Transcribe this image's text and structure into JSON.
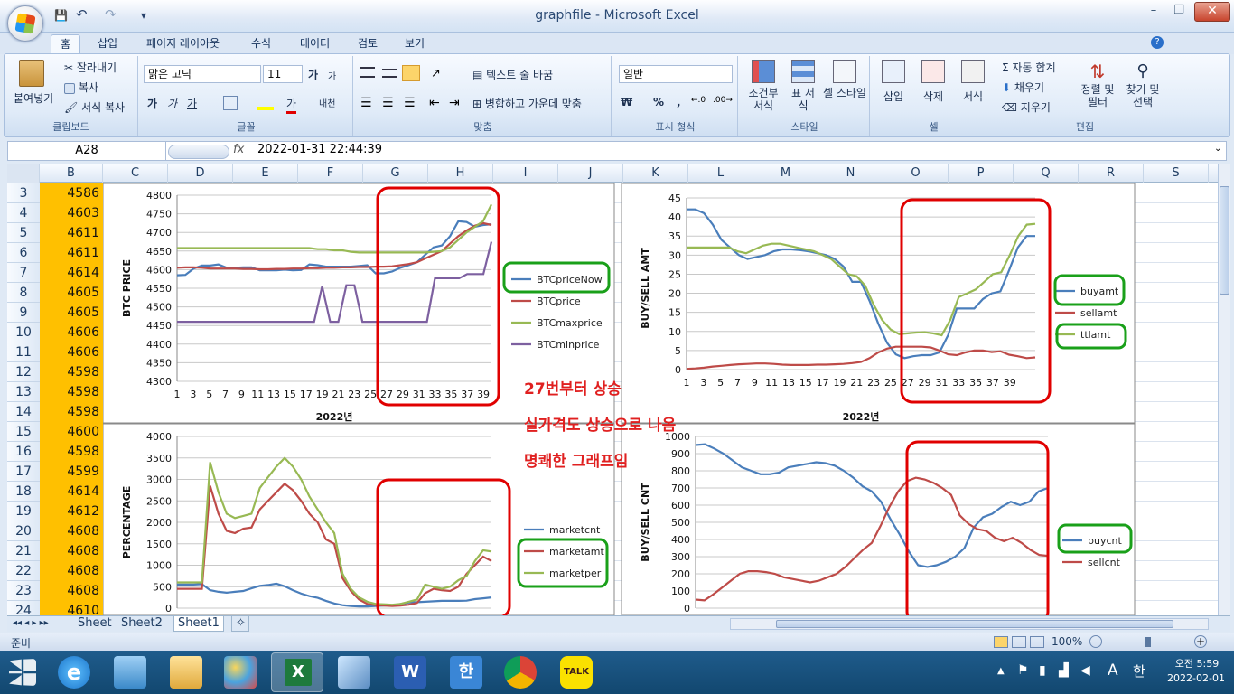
{
  "titlebar": {
    "title": "graphfile - Microsoft Excel",
    "qat_save": "💾",
    "qat_undo": "↶",
    "qat_redo": "↷",
    "qat_more": "▾"
  },
  "window_controls": {
    "minimize": "–",
    "restore": "❐",
    "close": "✕"
  },
  "ribbon_tabs": [
    "홈",
    "삽입",
    "페이지 레이아웃",
    "수식",
    "데이터",
    "검토",
    "보기"
  ],
  "ribbon": {
    "clipboard": {
      "paste": "붙여넣기",
      "cut": "잘라내기",
      "copy": "복사",
      "format_painter": "서식 복사",
      "label": "클립보드"
    },
    "font": {
      "name": "맑은 고딕",
      "size": "11",
      "grow": "가",
      "shrink": "가",
      "bold": "가",
      "italic": "가",
      "underline": "가",
      "color_glyph": "가",
      "phonetic": "내천",
      "label": "글꼴"
    },
    "alignment": {
      "wrap_text": "텍스트 줄 바꿈",
      "merge_center": "병합하고 가운데 맞춤",
      "label": "맞춤"
    },
    "number": {
      "format": "일반",
      "currency": "₩",
      "percent": "%",
      "comma": ",",
      "label": "표시 형식"
    },
    "styles": {
      "conditional": "조건부 서식",
      "table": "표 서식",
      "cell_style": "셀 스타일",
      "label": "스타일"
    },
    "cells": {
      "insert": "삽입",
      "delete": "삭제",
      "format": "서식",
      "label": "셀"
    },
    "editing": {
      "autosum": "자동 합계",
      "fill": "채우기",
      "clear": "지우기",
      "sort": "정렬 및 필터",
      "find": "찾기 및 선택",
      "label": "편집"
    }
  },
  "formula_bar": {
    "name_box": "A28",
    "fx": "fx",
    "value": "2022-01-31 22:44:39"
  },
  "columns": [
    "B",
    "C",
    "D",
    "E",
    "F",
    "G",
    "H",
    "I",
    "J",
    "K",
    "L",
    "M",
    "N",
    "O",
    "P",
    "Q",
    "R",
    "S"
  ],
  "rows": [
    {
      "num": "3",
      "b": "4586"
    },
    {
      "num": "4",
      "b": "4603"
    },
    {
      "num": "5",
      "b": "4611"
    },
    {
      "num": "6",
      "b": "4611"
    },
    {
      "num": "7",
      "b": "4614"
    },
    {
      "num": "8",
      "b": "4605"
    },
    {
      "num": "9",
      "b": "4605"
    },
    {
      "num": "10",
      "b": "4606"
    },
    {
      "num": "11",
      "b": "4606"
    },
    {
      "num": "12",
      "b": "4598"
    },
    {
      "num": "13",
      "b": "4598"
    },
    {
      "num": "14",
      "b": "4598"
    },
    {
      "num": "15",
      "b": "4600"
    },
    {
      "num": "16",
      "b": "4598"
    },
    {
      "num": "17",
      "b": "4599"
    },
    {
      "num": "18",
      "b": "4614"
    },
    {
      "num": "19",
      "b": "4612"
    },
    {
      "num": "20",
      "b": "4608"
    },
    {
      "num": "21",
      "b": "4608"
    },
    {
      "num": "22",
      "b": "4608"
    },
    {
      "num": "23",
      "b": "4608"
    },
    {
      "num": "24",
      "b": "4610"
    }
  ],
  "annotations": [
    "27번부터 상승",
    "실가격도 상승으로 나옴",
    "명쾌한 그래프임"
  ],
  "chart_data": [
    {
      "type": "line",
      "ylabel": "BTC PRICE",
      "xlabel": "2022년",
      "ylim": [
        4300,
        4800
      ],
      "yticks": [
        "4800",
        "4750",
        "4700",
        "4650",
        "4600",
        "4550",
        "4500",
        "4450",
        "4400",
        "4350",
        "4300"
      ],
      "xticks": [
        "1",
        "3",
        "5",
        "7",
        "9",
        "11",
        "13",
        "15",
        "17",
        "19",
        "21",
        "23",
        "25",
        "27",
        "29",
        "31",
        "33",
        "35",
        "37",
        "39"
      ],
      "series": [
        {
          "name": "BTCpriceNow",
          "color": "#4a7ebb",
          "values": [
            4585,
            4586,
            4603,
            4611,
            4611,
            4614,
            4605,
            4605,
            4606,
            4606,
            4598,
            4598,
            4598,
            4600,
            4598,
            4599,
            4614,
            4612,
            4608,
            4608,
            4608,
            4608,
            4610,
            4612,
            4590,
            4590,
            4595,
            4605,
            4612,
            4620,
            4640,
            4660,
            4665,
            4690,
            4730,
            4728,
            4715,
            4720,
            4722
          ]
        },
        {
          "name": "BTCprice",
          "color": "#be4b48",
          "values": [
            4605,
            4606,
            4606,
            4605,
            4603,
            4603,
            4603,
            4603,
            4602,
            4602,
            4601,
            4601,
            4602,
            4602,
            4603,
            4603,
            4604,
            4604,
            4605,
            4605,
            4606,
            4606,
            4607,
            4607,
            4608,
            4608,
            4609,
            4612,
            4615,
            4620,
            4630,
            4640,
            4650,
            4670,
            4690,
            4705,
            4718,
            4725,
            4720
          ]
        },
        {
          "name": "BTCmaxprice",
          "color": "#98b954",
          "values": [
            4658,
            4658,
            4658,
            4658,
            4658,
            4658,
            4658,
            4658,
            4658,
            4658,
            4658,
            4658,
            4658,
            4658,
            4658,
            4658,
            4658,
            4655,
            4655,
            4652,
            4652,
            4648,
            4646,
            4646,
            4646,
            4646,
            4646,
            4646,
            4646,
            4646,
            4646,
            4648,
            4650,
            4660,
            4680,
            4700,
            4715,
            4730,
            4775
          ]
        },
        {
          "name": "BTCminprice",
          "color": "#7d60a0",
          "values": [
            4460,
            4460,
            4460,
            4460,
            4460,
            4460,
            4460,
            4460,
            4460,
            4460,
            4460,
            4460,
            4460,
            4460,
            4460,
            4460,
            4460,
            4460,
            4555,
            4460,
            4460,
            4558,
            4558,
            4460,
            4460,
            4460,
            4460,
            4460,
            4460,
            4460,
            4460,
            4460,
            4577,
            4577,
            4577,
            4577,
            4588,
            4588,
            4588,
            4675
          ]
        }
      ]
    },
    {
      "type": "line",
      "ylabel": "BUY/SELL AMT",
      "xlabel": "2022년",
      "ylim": [
        0,
        45
      ],
      "yticks": [
        "45",
        "40",
        "35",
        "30",
        "25",
        "20",
        "15",
        "10",
        "5",
        "0"
      ],
      "xticks": [
        "1",
        "3",
        "5",
        "7",
        "9",
        "11",
        "13",
        "15",
        "17",
        "19",
        "21",
        "23",
        "25",
        "27",
        "29",
        "31",
        "33",
        "35",
        "37",
        "39"
      ],
      "series": [
        {
          "name": "buyamt",
          "color": "#4a7ebb",
          "values": [
            42,
            42,
            41,
            38,
            34,
            32,
            30,
            29,
            29.5,
            30,
            31,
            31.5,
            31.5,
            31.3,
            31,
            30.5,
            30,
            29,
            27,
            23,
            23,
            18,
            12,
            7,
            4,
            3,
            3.5,
            3.8,
            3.8,
            4.5,
            9,
            16,
            16,
            16,
            18.5,
            20,
            20.5,
            26,
            32,
            35,
            35
          ]
        },
        {
          "name": "sellamt",
          "color": "#be4b48",
          "values": [
            0.2,
            0.3,
            0.5,
            0.8,
            1,
            1.2,
            1.4,
            1.5,
            1.6,
            1.6,
            1.5,
            1.3,
            1.2,
            1.2,
            1.2,
            1.3,
            1.3,
            1.4,
            1.5,
            1.7,
            2,
            3,
            4.5,
            5.5,
            6,
            6,
            6,
            6,
            5.8,
            5,
            4,
            3.8,
            4.5,
            5,
            5,
            4.6,
            4.8,
            3.9,
            3.5,
            3,
            3.2
          ]
        },
        {
          "name": "ttlamt",
          "color": "#98b954",
          "values": [
            32,
            32,
            32,
            32,
            32,
            32,
            31,
            30.5,
            31.5,
            32.5,
            33,
            33,
            32.5,
            32,
            31.5,
            31,
            30,
            29,
            27,
            25,
            24.5,
            22,
            17,
            13,
            10.5,
            9.3,
            9.5,
            9.7,
            9.8,
            9.5,
            9,
            13,
            19,
            20,
            21,
            23,
            25,
            25.5,
            30,
            35,
            38,
            38.2
          ]
        }
      ]
    },
    {
      "type": "line",
      "ylabel": "PERCENTAGE",
      "xlabel": "",
      "ylim": [
        0,
        4000
      ],
      "yticks": [
        "4000",
        "3500",
        "3000",
        "2500",
        "2000",
        "1500",
        "1000",
        "500",
        "0"
      ],
      "series": [
        {
          "name": "marketcnt",
          "color": "#4a7ebb",
          "values": [
            550,
            550,
            550,
            560,
            420,
            380,
            360,
            380,
            400,
            460,
            520,
            540,
            570,
            510,
            420,
            340,
            280,
            240,
            170,
            110,
            70,
            50,
            40,
            40,
            50,
            60,
            70,
            100,
            130,
            140,
            150,
            160,
            170,
            170,
            170,
            175,
            210,
            230,
            250
          ]
        },
        {
          "name": "marketamt",
          "color": "#be4b48",
          "values": [
            450,
            450,
            450,
            450,
            2850,
            2200,
            1800,
            1750,
            1850,
            1880,
            2300,
            2500,
            2700,
            2900,
            2750,
            2500,
            2200,
            2000,
            1600,
            1500,
            700,
            400,
            200,
            100,
            70,
            60,
            50,
            60,
            80,
            120,
            350,
            450,
            420,
            400,
            500,
            800,
            1000,
            1200,
            1100
          ]
        },
        {
          "name": "marketper",
          "color": "#98b954",
          "values": [
            600,
            600,
            600,
            600,
            3400,
            2700,
            2200,
            2100,
            2150,
            2200,
            2800,
            3050,
            3300,
            3500,
            3300,
            3000,
            2600,
            2300,
            2000,
            1750,
            800,
            450,
            250,
            150,
            100,
            90,
            80,
            100,
            150,
            200,
            550,
            500,
            450,
            500,
            650,
            750,
            1100,
            1350,
            1320
          ]
        }
      ]
    },
    {
      "type": "line",
      "ylabel": "BUY/SELL CNT",
      "xlabel": "",
      "ylim": [
        0,
        1000
      ],
      "yticks": [
        "1000",
        "900",
        "800",
        "700",
        "600",
        "500",
        "400",
        "300",
        "200",
        "100",
        "0"
      ],
      "series": [
        {
          "name": "buycnt",
          "color": "#4a7ebb",
          "values": [
            950,
            955,
            930,
            900,
            860,
            820,
            800,
            780,
            780,
            790,
            820,
            830,
            840,
            850,
            845,
            830,
            800,
            760,
            710,
            680,
            620,
            520,
            430,
            330,
            250,
            240,
            250,
            270,
            300,
            350,
            470,
            530,
            550,
            590,
            620,
            600,
            620,
            680,
            700
          ]
        },
        {
          "name": "sellcnt",
          "color": "#be4b48",
          "values": [
            50,
            45,
            80,
            120,
            160,
            200,
            215,
            215,
            210,
            200,
            180,
            170,
            160,
            150,
            160,
            180,
            200,
            240,
            290,
            340,
            380,
            480,
            590,
            680,
            740,
            760,
            750,
            730,
            700,
            660,
            540,
            490,
            460,
            450,
            410,
            390,
            410,
            380,
            340,
            310,
            305
          ]
        }
      ]
    }
  ],
  "sheet_tabs": [
    "Sheet",
    "Sheet2",
    "Sheet1"
  ],
  "status": {
    "ready": "준비",
    "zoom": "100%"
  },
  "taskbar": {
    "clock_time": "오전 5:59",
    "clock_date": "2022-02-01",
    "ime": "A",
    "lang": "한",
    "kakao": "TALK"
  }
}
